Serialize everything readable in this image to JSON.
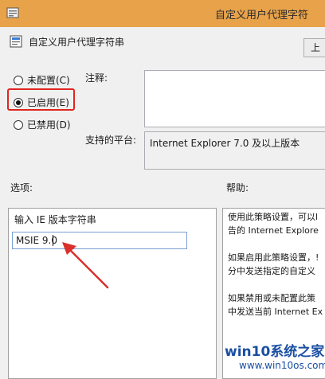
{
  "window": {
    "title": "自定义用户代理字符"
  },
  "header": {
    "policy_name": "自定义用户代理字符串",
    "prev_setting_label": "上"
  },
  "state_options": [
    {
      "label": "未配置(C)",
      "checked": false
    },
    {
      "label": "已启用(E)",
      "checked": true
    },
    {
      "label": "已禁用(D)",
      "checked": false
    }
  ],
  "comment": {
    "label": "注释:",
    "value": ""
  },
  "supported_on": {
    "label": "支持的平台:",
    "value": "Internet Explorer 7.0 及以上版本"
  },
  "options": {
    "label": "选项:",
    "ua_label": "输入 IE 版本字符串",
    "ua_value": "MSIE 9.0"
  },
  "help": {
    "label": "帮助:",
    "lines": [
      "使用此策略设置，可以l",
      "告的 Internet Explore",
      "",
      "如果启用此策略设置，!",
      "分中发送指定的自定义",
      "",
      "如果禁用或未配置此策",
      "中发送当前 Internet Ex"
    ]
  },
  "watermark": {
    "logo": "win10系统之家",
    "url": "www.win10os.com"
  },
  "colors": {
    "titlebar": "#e8a24a",
    "highlight_box": "#e0241f",
    "annotation_arrow": "#d9302b",
    "watermark": "#1a4fa3"
  }
}
